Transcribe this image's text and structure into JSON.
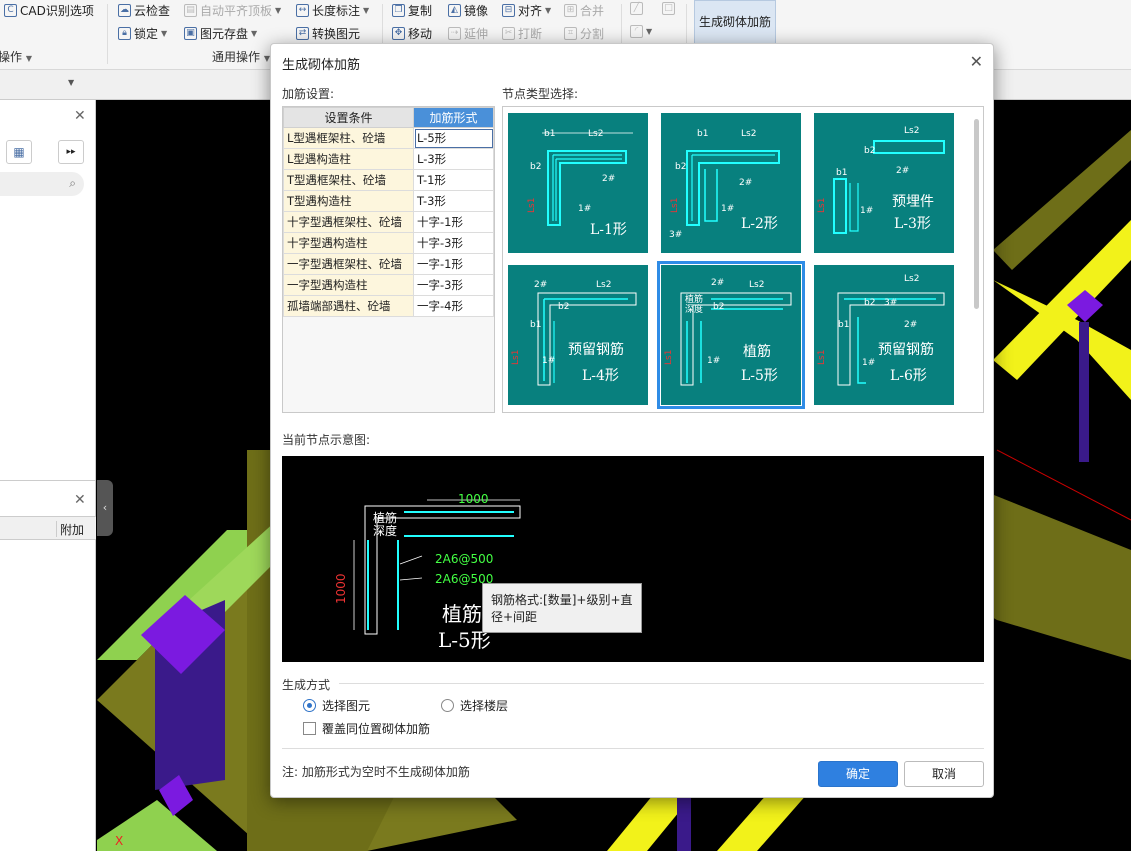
{
  "ribbon": {
    "cad_options": "CAD识别选项",
    "cloud_check": "云检查",
    "auto_align": "自动平齐顶板",
    "length_mark": "长度标注",
    "copy": "复制",
    "mirror": "镜像",
    "align": "对齐",
    "merge": "合并",
    "lock": "锁定",
    "save_elem": "图元存盘",
    "convert_elem": "转换图元",
    "move": "移动",
    "extend": "延伸",
    "break": "打断",
    "split": "分割",
    "generate_btn": "生成砌体加筋",
    "group_ops_left": "操作",
    "group_common": "通用操作"
  },
  "left_panel": {
    "col_add": "附加"
  },
  "dialog": {
    "title": "生成砌体加筋",
    "settings_label": "加筋设置:",
    "node_type_label": "节点类型选择:",
    "table_headers": [
      "设置条件",
      "加筋形式"
    ],
    "rows": [
      {
        "condition": "L型遇框架柱、砼墙",
        "form": "L-5形"
      },
      {
        "condition": "L型遇构造柱",
        "form": "L-3形"
      },
      {
        "condition": "T型遇框架柱、砼墙",
        "form": "T-1形"
      },
      {
        "condition": "T型遇构造柱",
        "form": "T-3形"
      },
      {
        "condition": "十字型遇框架柱、砼墙",
        "form": "十字-1形"
      },
      {
        "condition": "十字型遇构造柱",
        "form": "十字-3形"
      },
      {
        "condition": "一字型遇框架柱、砼墙",
        "form": "一字-1形"
      },
      {
        "condition": "一字型遇构造柱",
        "form": "一字-3形"
      },
      {
        "condition": "孤墙端部遇柱、砼墙",
        "form": "一字-4形"
      }
    ],
    "node_cards": [
      {
        "caption": "L-1形",
        "sub": "",
        "selected": false
      },
      {
        "caption": "L-2形",
        "sub": "",
        "selected": false
      },
      {
        "caption": "L-3形",
        "sub": "预埋件",
        "selected": false
      },
      {
        "caption": "L-4形",
        "sub": "预留钢筋",
        "selected": false
      },
      {
        "caption": "L-5形",
        "sub": "植筋",
        "selected": true
      },
      {
        "caption": "L-6形",
        "sub": "预留钢筋",
        "selected": false
      }
    ],
    "card_labels": {
      "b1": "b1",
      "b2": "b2",
      "ls2": "Ls2",
      "ls1": "Ls1",
      "r1": "1#",
      "r2": "2#",
      "r3": "3#",
      "depth": "植筋深度"
    },
    "current_node_label": "当前节点示意图:",
    "preview": {
      "dim_top": "1000",
      "dim_left": "1000",
      "depth_label_1": "植筋",
      "depth_label_2": "深度",
      "bar_1": "2A6@500",
      "bar_2": "2A6@500",
      "big_1": "植筋",
      "big_2": "L-5形"
    },
    "tooltip": "钢筋格式:[数量]+级别+直径+间距",
    "gen_mode_label": "生成方式",
    "radio_elem": "选择图元",
    "radio_floor": "选择楼层",
    "overwrite_label": "覆盖同位置砌体加筋",
    "note": "注: 加筋形式为空时不生成砌体加筋",
    "ok": "确定",
    "cancel": "取消"
  }
}
